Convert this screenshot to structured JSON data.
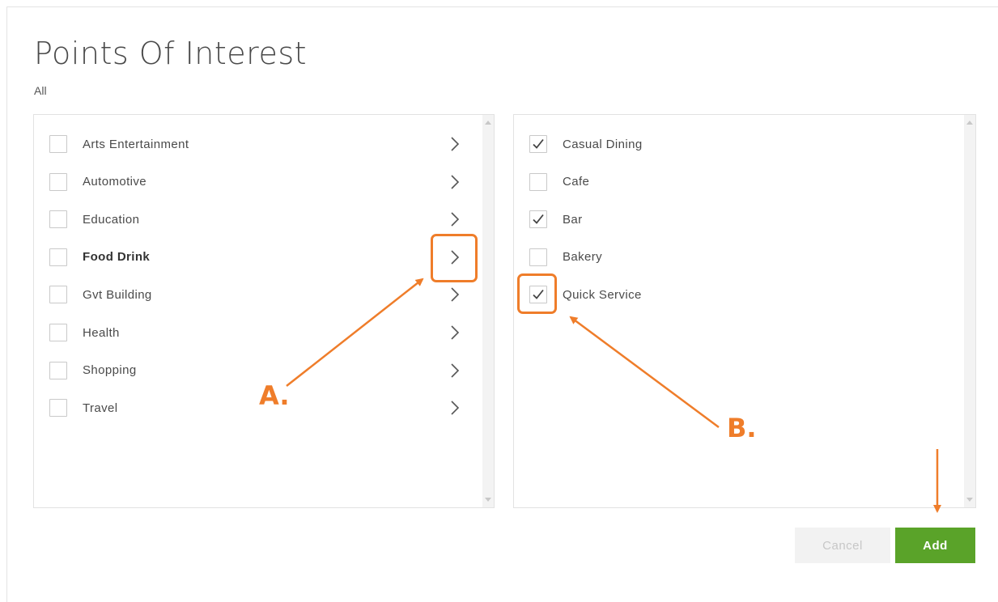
{
  "dialog": {
    "title": "Points Of Interest",
    "breadcrumb": "All"
  },
  "categories": [
    {
      "label": "Arts Entertainment",
      "checked": false,
      "active": false
    },
    {
      "label": "Automotive",
      "checked": false,
      "active": false
    },
    {
      "label": "Education",
      "checked": false,
      "active": false
    },
    {
      "label": "Food Drink",
      "checked": false,
      "active": true
    },
    {
      "label": "Gvt Building",
      "checked": false,
      "active": false
    },
    {
      "label": "Health",
      "checked": false,
      "active": false
    },
    {
      "label": "Shopping",
      "checked": false,
      "active": false
    },
    {
      "label": "Travel",
      "checked": false,
      "active": false
    }
  ],
  "subcategories": [
    {
      "label": "Casual Dining",
      "checked": true
    },
    {
      "label": "Cafe",
      "checked": false
    },
    {
      "label": "Bar",
      "checked": true
    },
    {
      "label": "Bakery",
      "checked": false
    },
    {
      "label": "Quick Service",
      "checked": true
    }
  ],
  "buttons": {
    "cancel": "Cancel",
    "add": "Add"
  },
  "annotations": {
    "a": "A.",
    "b": "B.",
    "color": "#ef7d2a"
  },
  "colors": {
    "add_button": "#5aa329",
    "annotation": "#ef7d2a"
  }
}
